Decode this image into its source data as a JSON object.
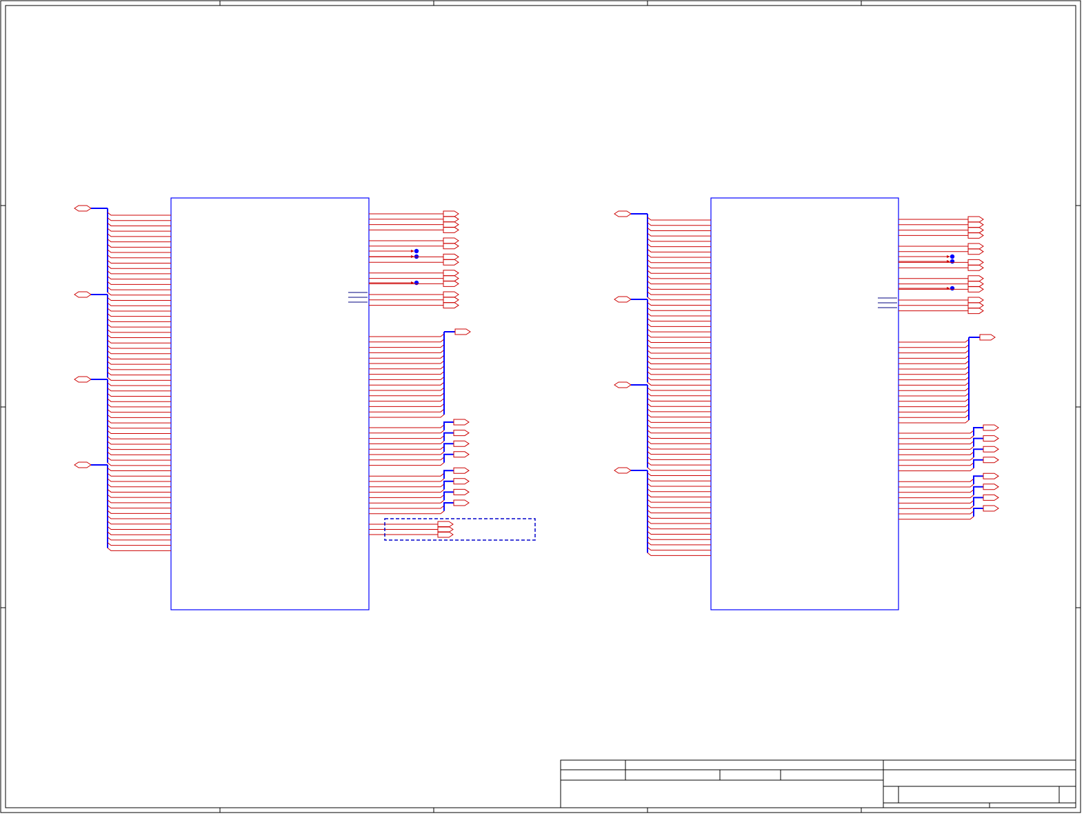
{
  "sheet": {
    "colors": {
      "frame": "#000000",
      "component": "#0000ff",
      "wire": "#cc0000",
      "bus": "#0000ff",
      "port": "#cc0000",
      "junction": "#0000ff",
      "keepout": "#0000cc",
      "stub": "#000080"
    }
  },
  "components": [
    {
      "id": "u-left",
      "input_buses": 4,
      "pins_per_bus": 16,
      "output_ports": [
        4,
        2,
        2,
        3,
        3
      ],
      "no_connects": 3,
      "bus_outputs": 8,
      "has_keepout": true
    },
    {
      "id": "u-right",
      "input_buses": 4,
      "pins_per_bus": 16,
      "output_ports": [
        4,
        2,
        2,
        3,
        3
      ],
      "no_connects": 3,
      "bus_outputs": 8,
      "has_keepout": false
    }
  ],
  "title_block": {
    "cells": []
  }
}
